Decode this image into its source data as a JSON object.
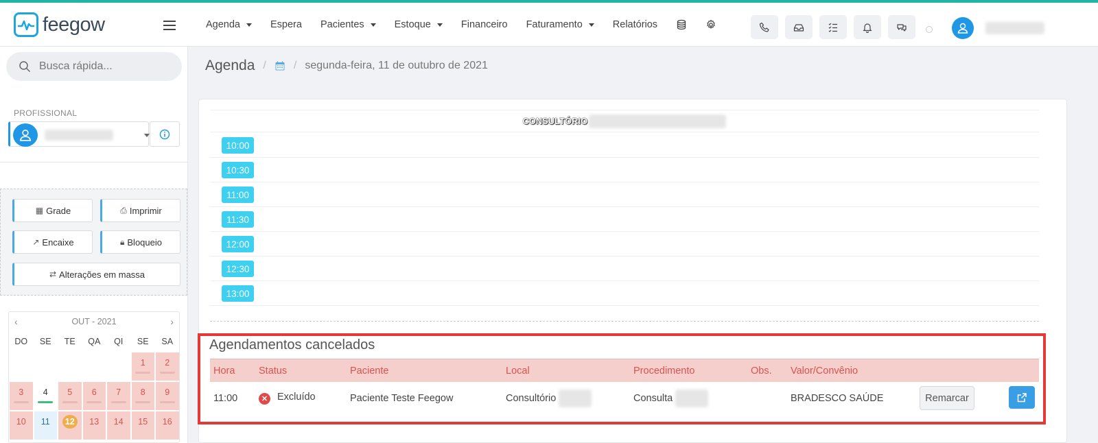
{
  "brand": {
    "name": "feegow"
  },
  "nav": {
    "items": [
      {
        "label": "Agenda",
        "dropdown": true
      },
      {
        "label": "Espera",
        "dropdown": false
      },
      {
        "label": "Pacientes",
        "dropdown": true
      },
      {
        "label": "Estoque",
        "dropdown": true
      },
      {
        "label": "Financeiro",
        "dropdown": false
      },
      {
        "label": "Faturamento",
        "dropdown": true
      },
      {
        "label": "Relatórios",
        "dropdown": false
      }
    ],
    "icons": [
      "database-icon",
      "gear-icon"
    ]
  },
  "toolbar": {
    "icons": [
      "phone-icon",
      "inbox-icon",
      "tasks-icon",
      "bell-icon",
      "chat-icon"
    ]
  },
  "sidebar": {
    "search_placeholder": "Busca rápida...",
    "profissional_label": "PROFISSIONAL",
    "buttons": {
      "grade": "Grade",
      "imprimir": "Imprimir",
      "encaixe": "Encaixe",
      "bloqueio": "Bloqueio",
      "alteracoes": "Alterações em massa"
    }
  },
  "calendar": {
    "month_label": "OUT - 2021",
    "weekdays": [
      "DO",
      "SE",
      "TE",
      "QA",
      "QI",
      "SE",
      "SA"
    ],
    "weeks": [
      [
        "",
        "",
        "",
        "",
        "",
        "1",
        "2"
      ],
      [
        "3",
        "4",
        "5",
        "6",
        "7",
        "8",
        "9"
      ],
      [
        "10",
        "11",
        "12",
        "13",
        "14",
        "15",
        "16"
      ]
    ],
    "selected_day": "11",
    "today_day": "12"
  },
  "breadcrumb": {
    "title": "Agenda",
    "date": "segunda-feira, 11 de outubro de 2021"
  },
  "schedule": {
    "room_label": "CONSULTÓRIO",
    "slots": [
      "10:00",
      "10:30",
      "11:00",
      "11:30",
      "12:00",
      "12:30",
      "13:00"
    ]
  },
  "cancelled": {
    "title": "Agendamentos cancelados",
    "headers": {
      "hora": "Hora",
      "status": "Status",
      "paciente": "Paciente",
      "local": "Local",
      "procedimento": "Procedimento",
      "obs": "Obs.",
      "valor": "Valor/Convênio"
    },
    "rows": [
      {
        "hora": "11:00",
        "status": "Excluído",
        "paciente": "Paciente Teste Feegow",
        "local": "Consultório",
        "procedimento": "Consulta",
        "obs": "",
        "valor": "BRADESCO SAÚDE",
        "action": "Remarcar"
      }
    ]
  },
  "colors": {
    "accent": "#1f97e6",
    "slot": "#3ed0f0",
    "danger": "#e53935",
    "cancel_header": "#f5cfcb"
  }
}
